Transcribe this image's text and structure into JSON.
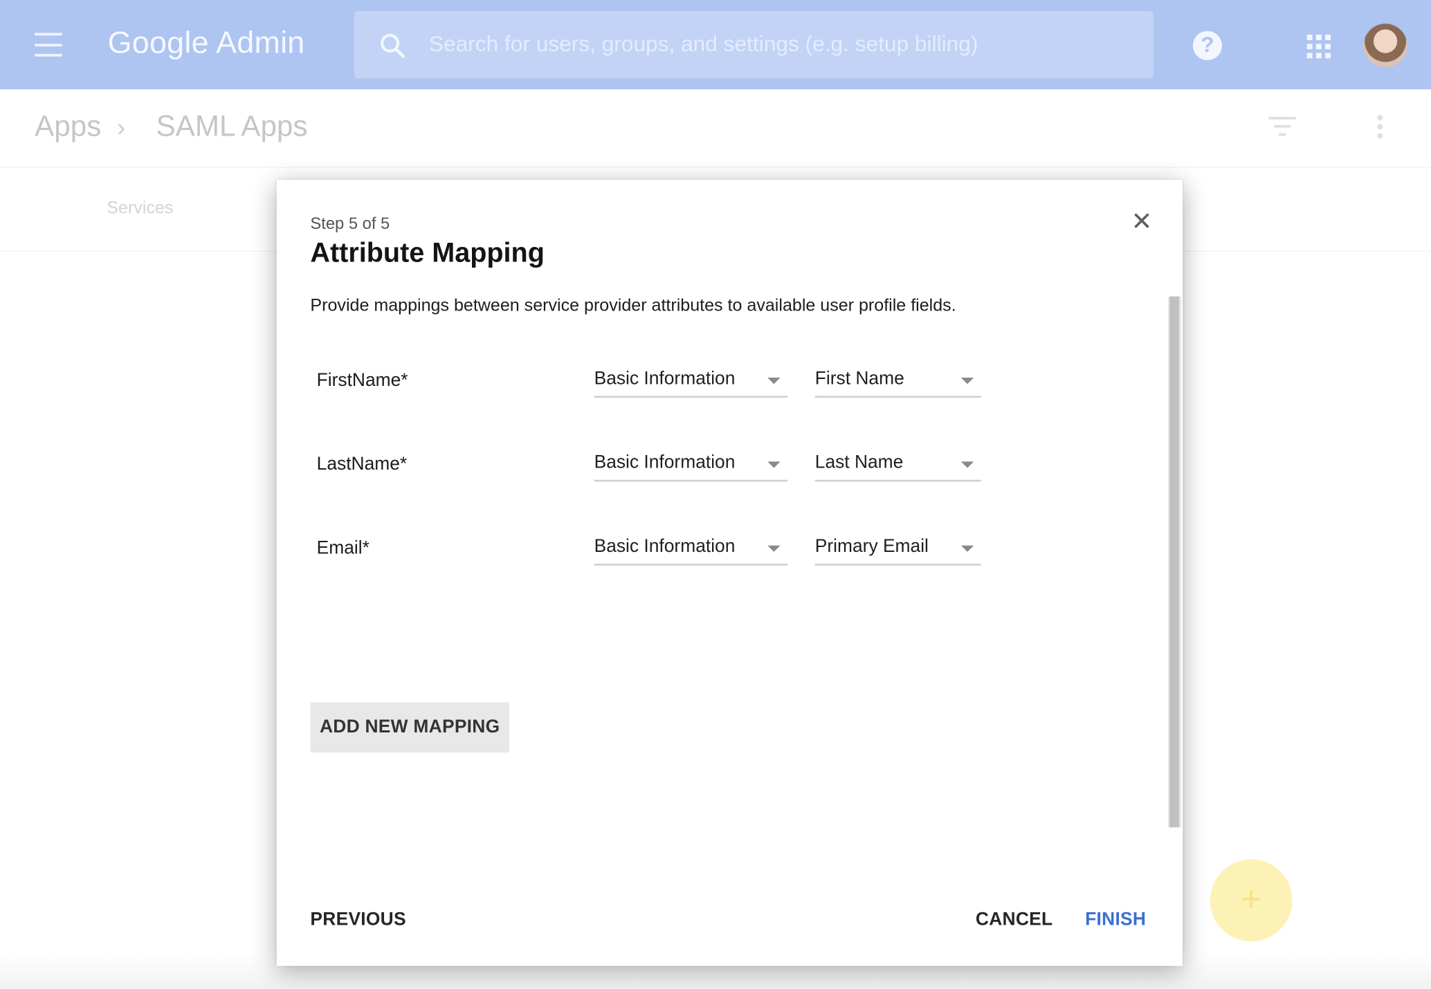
{
  "topbar": {
    "brand_google": "Google",
    "brand_admin": "Admin",
    "search_placeholder": "Search for users, groups, and settings (e.g. setup billing)"
  },
  "breadcrumb": {
    "items": [
      "Apps",
      "SAML Apps"
    ],
    "separator": "›"
  },
  "subnav": {
    "services_label": "Services"
  },
  "dialog": {
    "step": "Step 5 of 5",
    "title": "Attribute Mapping",
    "description": "Provide mappings between service provider attributes to available user profile fields.",
    "close_glyph": "✕",
    "mappings": [
      {
        "attribute": "FirstName*",
        "category": "Basic Information",
        "field": "First Name"
      },
      {
        "attribute": "LastName*",
        "category": "Basic Information",
        "field": "Last Name"
      },
      {
        "attribute": "Email*",
        "category": "Basic Information",
        "field": "Primary Email"
      }
    ],
    "add_mapping_label": "ADD NEW MAPPING",
    "previous_label": "PREVIOUS",
    "cancel_label": "CANCEL",
    "finish_label": "FINISH"
  },
  "fab_glyph": "+",
  "colors": {
    "topbar_dimmed": "#aec4f1",
    "finish_blue": "#3a6fd2",
    "fab_dimmed": "#fdf2b6"
  }
}
